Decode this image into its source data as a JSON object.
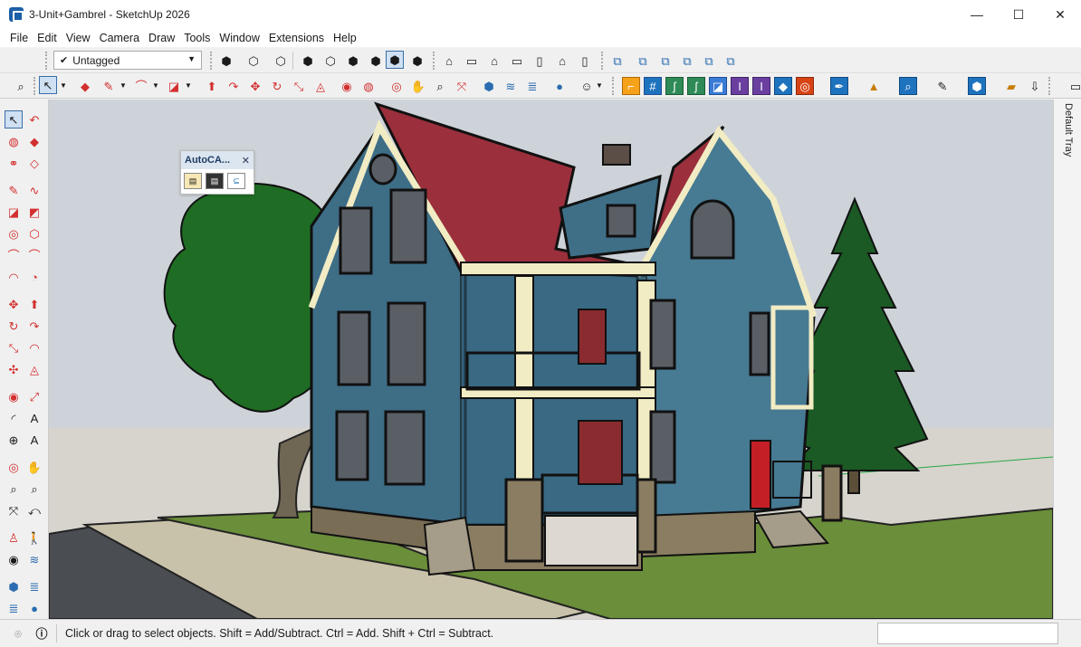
{
  "window": {
    "title": "3-Unit+Gambrel - SketchUp 2026",
    "minimize": "—",
    "maximize": "☐",
    "close": "✕"
  },
  "menu": [
    "File",
    "Edit",
    "View",
    "Camera",
    "Draw",
    "Tools",
    "Window",
    "Extensions",
    "Help"
  ],
  "tag_select": {
    "value": "Untagged"
  },
  "autocad_panel": {
    "title": "AutoCA...",
    "close": "✕"
  },
  "tray": {
    "label": "Default Tray"
  },
  "status": {
    "text": "Click or drag to select objects. Shift = Add/Subtract. Ctrl = Add. Shift + Ctrl = Subtract."
  },
  "colors": {
    "accent_orange": "#f7a21b",
    "accent_blue": "#3a7bd5",
    "sky": "#cdd3d8",
    "ground": "#d6d4cc",
    "grass": "#6a8e3a",
    "siding": "#3e6d86",
    "roof": "#9b2f3c",
    "trim": "#f2ecc4",
    "tree": "#1f6d24",
    "stone": "#8a7d62"
  }
}
